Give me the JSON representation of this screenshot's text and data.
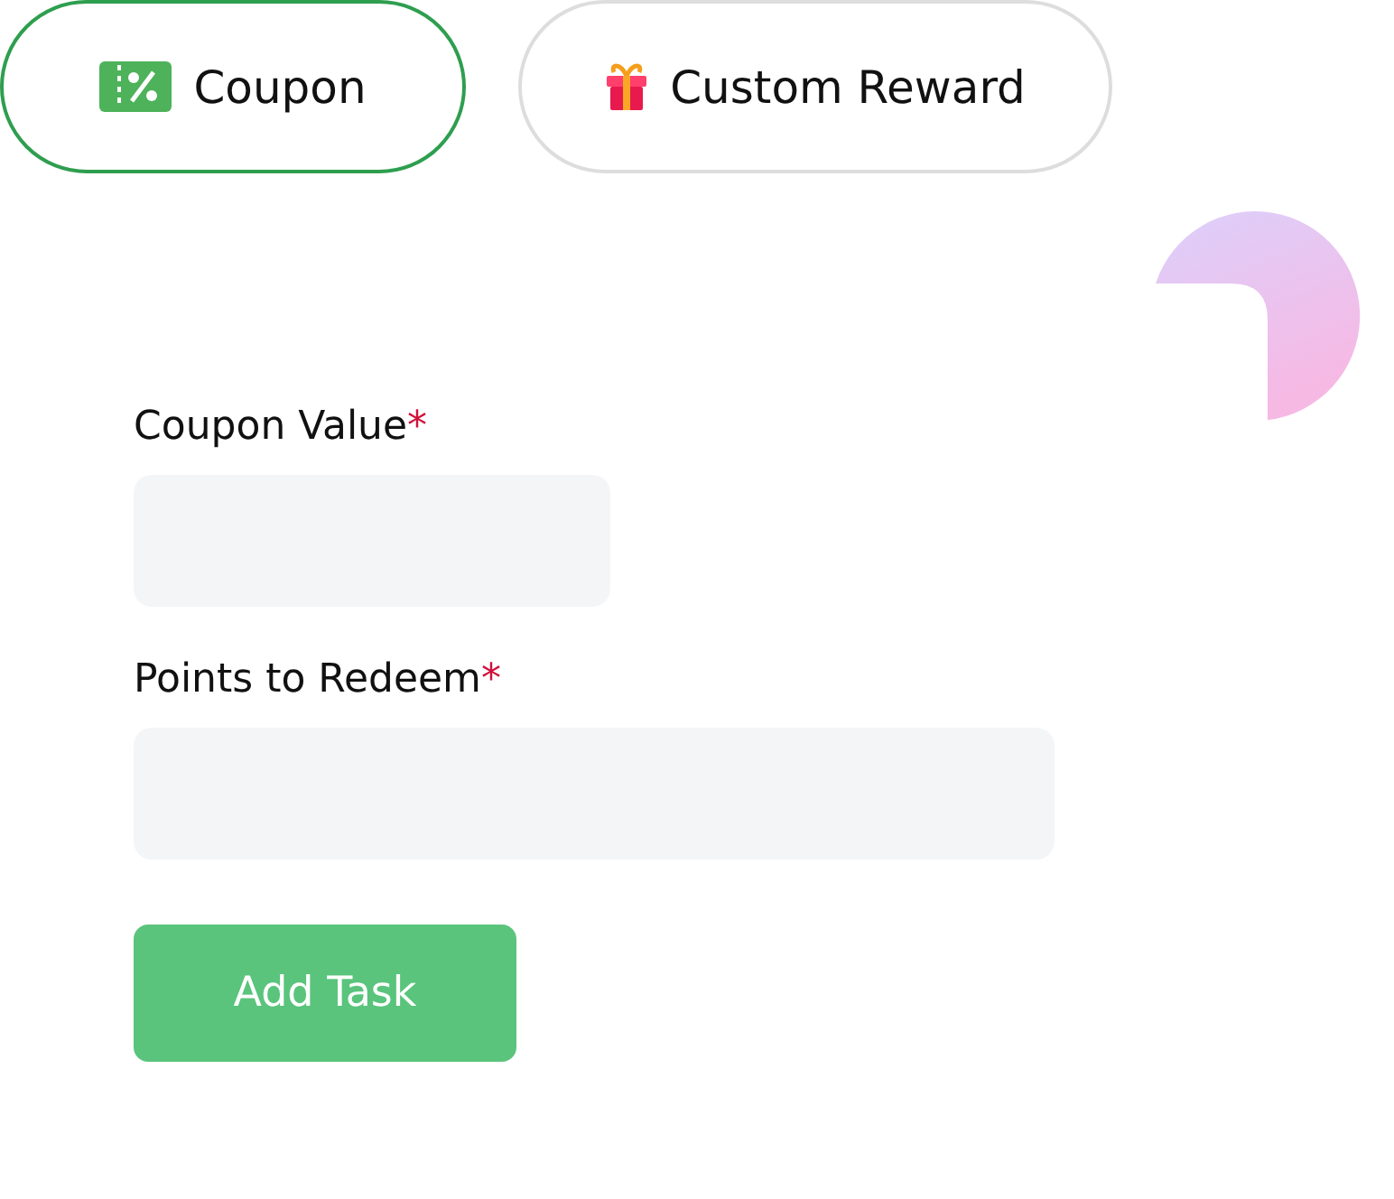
{
  "tabs": [
    {
      "label": "Coupon",
      "selected": true
    },
    {
      "label": "Custom Reward",
      "selected": false
    }
  ],
  "form": {
    "fields": [
      {
        "label": "Coupon Value",
        "required": true
      },
      {
        "label": "Points to Redeem",
        "required": true
      }
    ],
    "required_mark": "*",
    "submit": "Add Task"
  }
}
